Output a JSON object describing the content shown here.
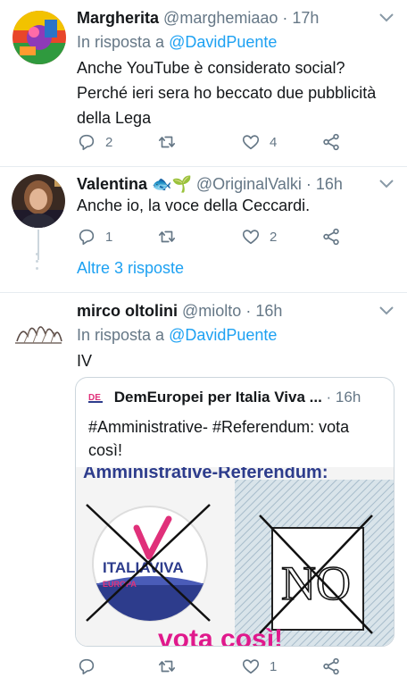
{
  "tweets": [
    {
      "name": "Margherita",
      "handle": "@marghemiaao",
      "time": "· 17h",
      "reply_prefix": "In risposta a ",
      "reply_handle": "@DavidPuente",
      "text_lines": [
        "Anche YouTube è considerato social?",
        "Perché ieri sera ho beccato due pubblicità",
        "della Lega"
      ],
      "replies": "2",
      "retweets": "",
      "likes": "4"
    },
    {
      "name": "Valentina",
      "emoji": "🐟🌱",
      "handle": "@OriginalValki",
      "time": "· 16h",
      "text_lines": [
        "Anche io, la voce della Ceccardi."
      ],
      "replies": "1",
      "retweets": "",
      "likes": "2",
      "more_replies": "Altre 3 risposte"
    },
    {
      "name": "mirco oltolini",
      "handle": "@miolto",
      "time": "· 16h",
      "reply_prefix": "In risposta a ",
      "reply_handle": "@DavidPuente",
      "text_lines": [
        "IV"
      ],
      "replies": "",
      "retweets": "",
      "likes": "1",
      "quoted": {
        "name": "DemEuropei per Italia Viva ...",
        "time": "· 16h",
        "text_lines": [
          "#Amministrative- #Referendum: vota",
          "così!"
        ],
        "image": {
          "banner": "Amministrative-Referendum:",
          "logo_line1": "ITALIAVIVA",
          "logo_line2": "EUROPA",
          "no_text": "NO",
          "footer": "vota così!"
        }
      }
    }
  ],
  "colors": {
    "accent": "#1da1f2",
    "muted": "#657786",
    "text": "#14171a",
    "divider": "#e6ecf0",
    "banner_blue": "#2d3c8c",
    "footer_pink": "#e0198c",
    "iv_red": "#e0307a"
  },
  "icons": {
    "reply": "reply-icon",
    "retweet": "retweet-icon",
    "like": "heart-icon",
    "share": "share-icon",
    "caret": "chevron-down-icon"
  }
}
